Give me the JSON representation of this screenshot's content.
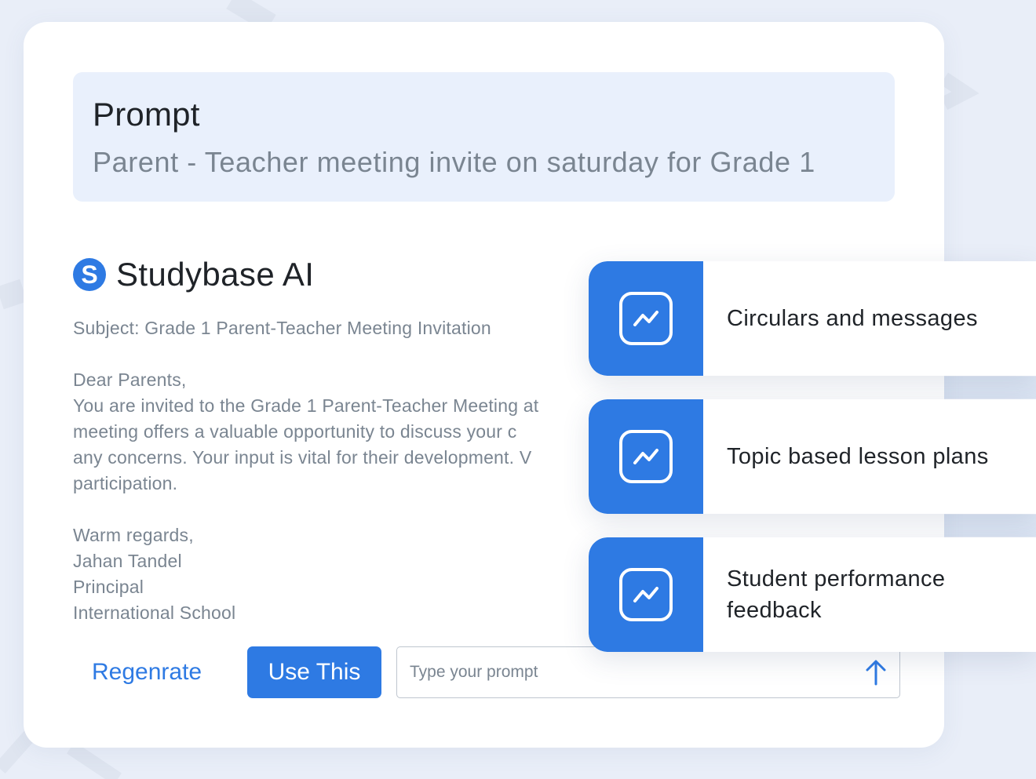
{
  "prompt": {
    "title": "Prompt",
    "text": "Parent - Teacher meeting invite on saturday for Grade 1"
  },
  "ai": {
    "logo_letter": "S",
    "name": "Studybase AI"
  },
  "email": {
    "subject": "Subject: Grade 1 Parent-Teacher Meeting Invitation",
    "greeting": "Dear Parents,",
    "body_lines": [
      "You are invited to the Grade 1 Parent-Teacher Meeting at",
      "meeting offers a valuable opportunity to discuss your c",
      "any concerns. Your input is vital for their development. V",
      "participation."
    ],
    "closing": "Warm regards,",
    "signature_name": "Jahan Tandel",
    "signature_title": "Principal",
    "signature_org": "International School"
  },
  "actions": {
    "regenerate_label": "Regenrate",
    "use_label": "Use This",
    "input_placeholder": "Type your prompt",
    "input_value": ""
  },
  "features": [
    {
      "label": "Circulars and messages",
      "icon": "trend-chart-icon"
    },
    {
      "label": "Topic based lesson plans",
      "icon": "trend-chart-icon"
    },
    {
      "label": "Student performance feedback",
      "icon": "trend-chart-icon"
    }
  ],
  "colors": {
    "accent": "#2e7ae3",
    "page_background": "#e9eef8",
    "prompt_background": "#e9f0fc",
    "muted_text": "#7a8591",
    "dark_text": "#1f2328"
  }
}
